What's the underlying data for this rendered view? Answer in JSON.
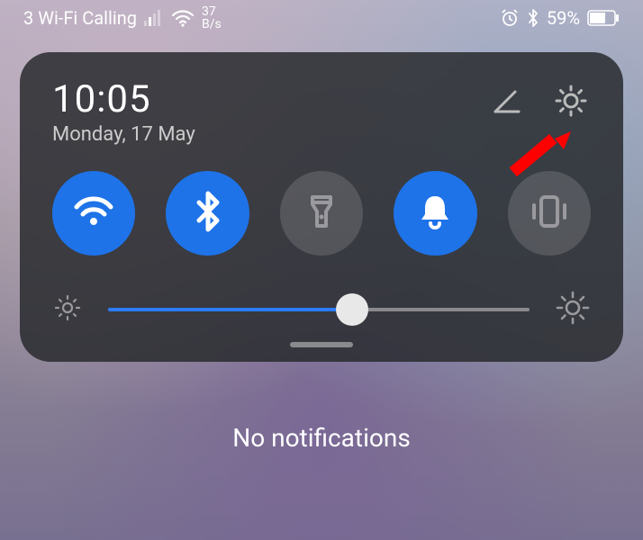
{
  "statusbar": {
    "carrier": "3 Wi-Fi Calling",
    "net_speed_top": "37",
    "net_speed_bottom": "B/s",
    "battery_pct": "59%"
  },
  "panel": {
    "time": "10:05",
    "date": "Monday, 17 May",
    "brightness": {
      "value": 0.58
    },
    "toggles": {
      "wifi": {
        "on": true
      },
      "bluetooth": {
        "on": true
      },
      "flashlight": {
        "on": false
      },
      "sound": {
        "on": true
      },
      "vibrate": {
        "on": false
      }
    }
  },
  "notifications": {
    "empty_text": "No notifications"
  },
  "colors": {
    "accent": "#1e73e8",
    "arrow": "#ff0000"
  }
}
